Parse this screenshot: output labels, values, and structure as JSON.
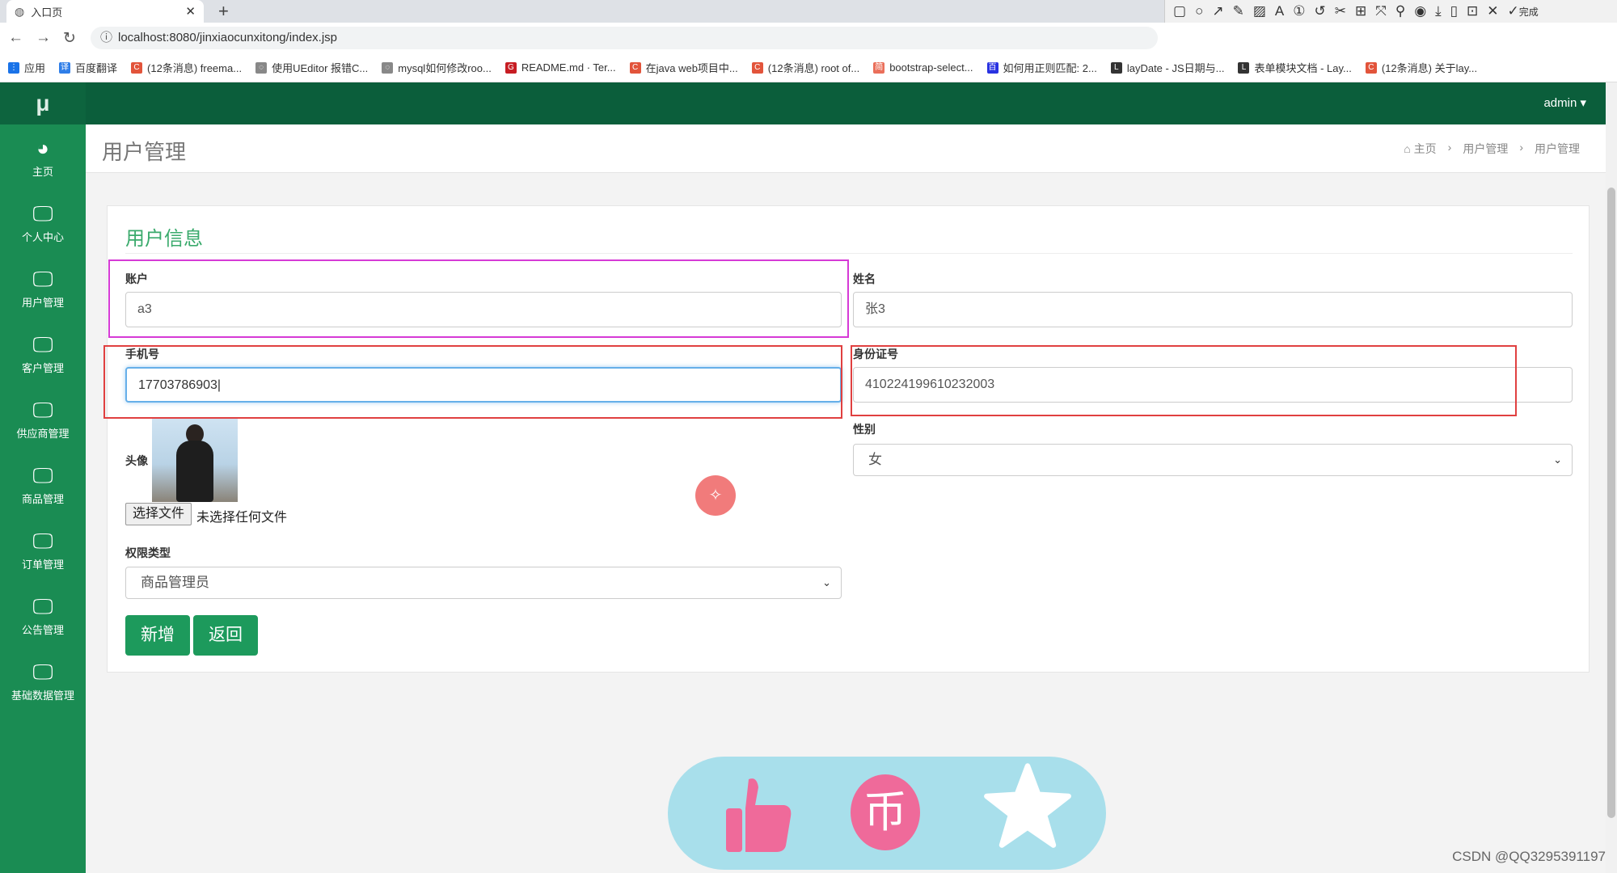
{
  "browser": {
    "tab_title": "入口页",
    "url": "localhost:8080/jinxiaocunxitong/index.jsp",
    "bookmarks": [
      "应用",
      "百度翻译",
      "(12条消息) freema...",
      "使用UEditor 报错C...",
      "mysql如何修改roo...",
      "README.md · Ter...",
      "在java web项目中...",
      "(12条消息) root of...",
      "bootstrap-select...",
      "如何用正则匹配: 2...",
      "layDate - JS日期与...",
      "表单模块文档 - Lay...",
      "(12条消息) 关于lay..."
    ],
    "toolbar": {
      "font_size": "18",
      "done_label": "完成",
      "main_color": "#e53935"
    }
  },
  "app": {
    "logo": "μ",
    "admin_label": "admin",
    "sidebar": [
      {
        "label": "主页",
        "icon": "dashboard-icon"
      },
      {
        "label": "个人中心",
        "icon": "monitor-icon"
      },
      {
        "label": "用户管理",
        "icon": "monitor-icon"
      },
      {
        "label": "客户管理",
        "icon": "monitor-icon"
      },
      {
        "label": "供应商管理",
        "icon": "monitor-icon"
      },
      {
        "label": "商品管理",
        "icon": "monitor-icon"
      },
      {
        "label": "订单管理",
        "icon": "monitor-icon"
      },
      {
        "label": "公告管理",
        "icon": "monitor-icon"
      },
      {
        "label": "基础数据管理",
        "icon": "monitor-icon"
      }
    ],
    "page_title": "用户管理",
    "breadcrumb": [
      "主页",
      "用户管理",
      "用户管理"
    ],
    "form": {
      "section_title": "用户信息",
      "account_label": "账户",
      "account_value": "a3",
      "name_label": "姓名",
      "name_value": "张3",
      "phone_label": "手机号",
      "phone_value": "17703786903",
      "idcard_label": "身份证号",
      "idcard_value": "410224199610232003",
      "avatar_label": "头像",
      "file_button": "选择文件",
      "file_status": "未选择任何文件",
      "gender_label": "性别",
      "gender_value": "女",
      "role_label": "权限类型",
      "role_value": "商品管理员",
      "add_button": "新增",
      "back_button": "返回"
    }
  },
  "overlay": {
    "watermark": "CSDN @QQ3295391197"
  }
}
